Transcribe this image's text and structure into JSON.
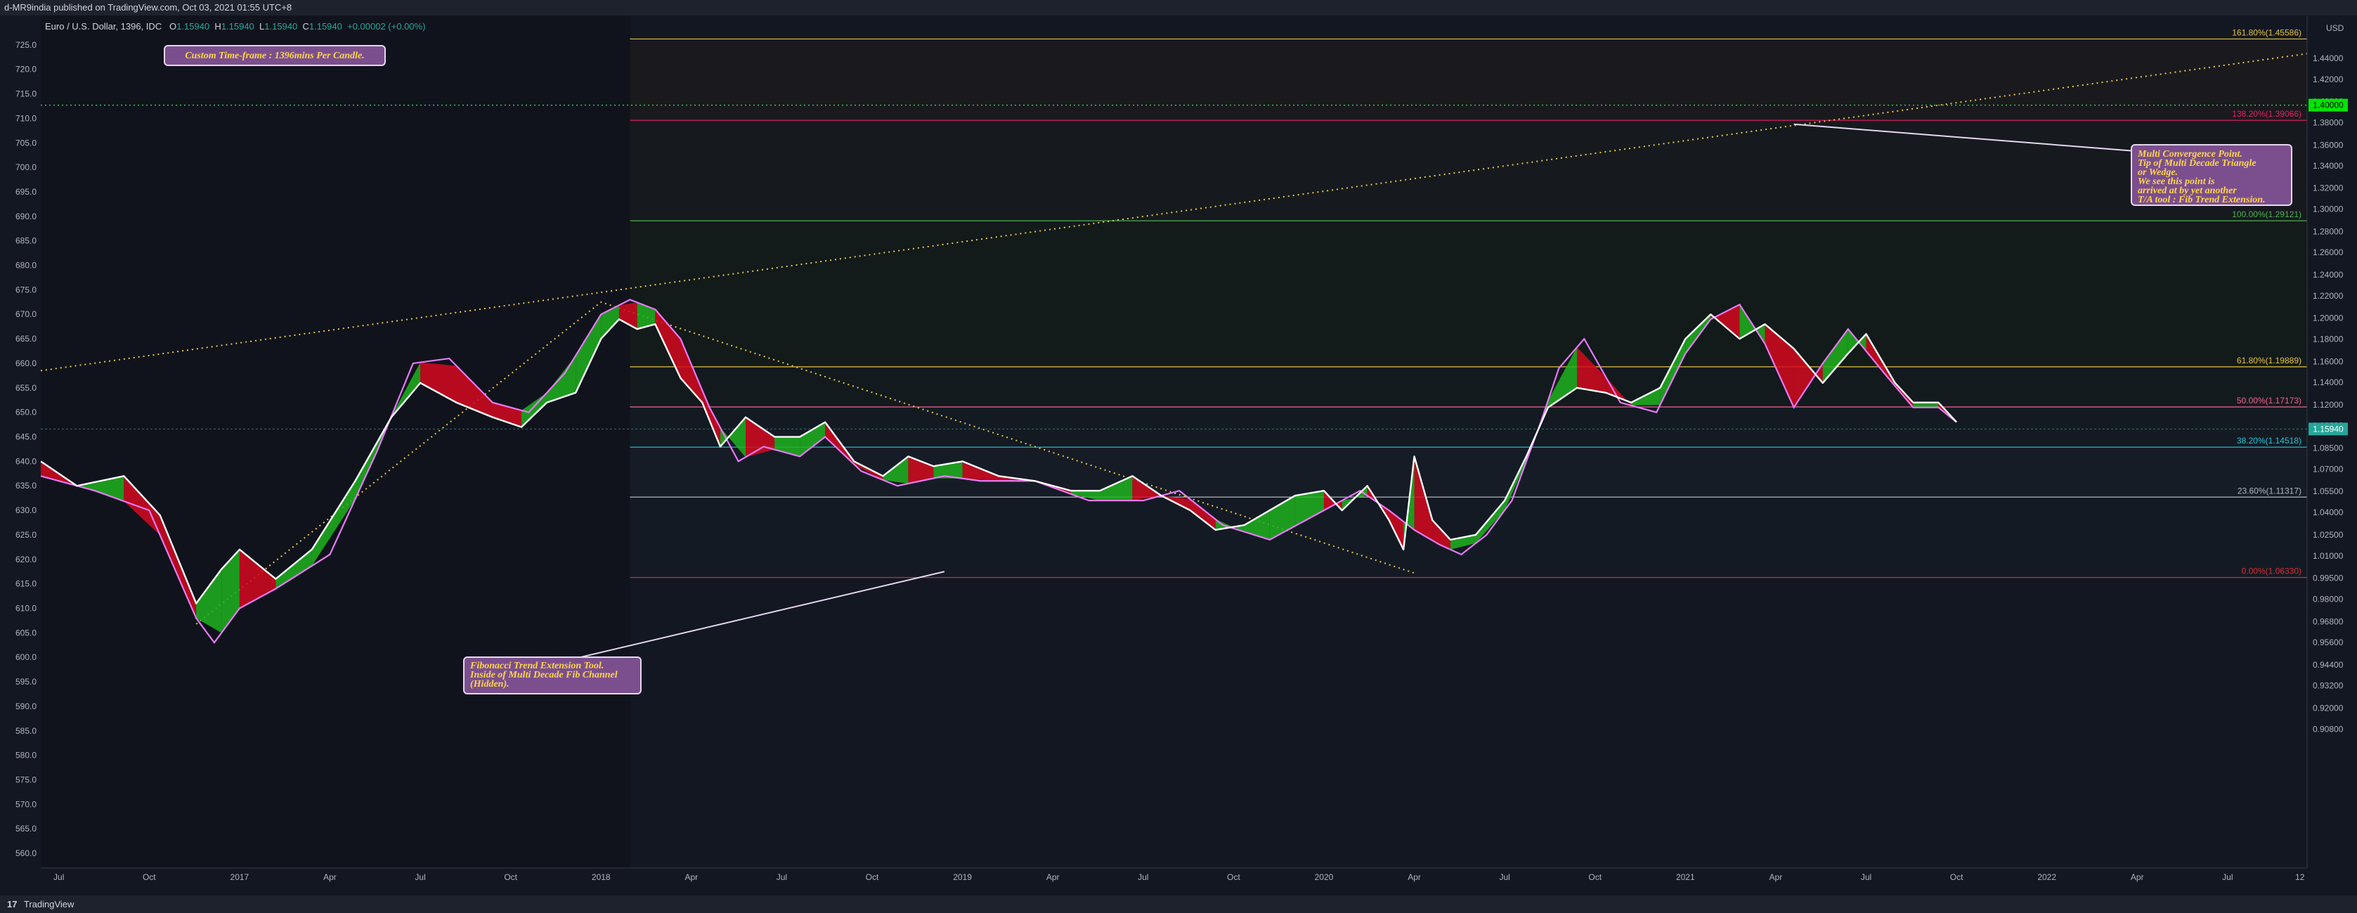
{
  "header": {
    "publisher": "d-MR9india published on TradingView.com, Oct 03, 2021 01:55 UTC+8",
    "symbol": "Euro / U.S. Dollar, 1396, IDC",
    "ohlc": {
      "o_label": "O",
      "o": "1.15940",
      "h_label": "H",
      "h": "1.15940",
      "l_label": "L",
      "l": "1.15940",
      "c_label": "C",
      "c": "1.15940",
      "change": "+0.00002 (+0.00%)"
    }
  },
  "footer": {
    "logo": "17",
    "brand": "TradingView"
  },
  "annotations": {
    "timeframe": "Custom Time-frame : 1396mins Per Candle.",
    "fib_tool": [
      "Fibonacci Trend Extension Tool.",
      "Inside of Multi Decade Fib Channel",
      "(Hidden)."
    ],
    "convergence": [
      "Multi Convergence Point.",
      "Tip of Multi Decade Triangle",
      "or Wedge.",
      "We see this point is",
      "arrived at by yet another",
      "T/A tool : Fib Trend Extension."
    ]
  },
  "chart_data": {
    "type": "line",
    "title": "Euro / U.S. Dollar, 1396, IDC",
    "right_axis_unit": "USD",
    "colors": {
      "background": "#131722",
      "price": "#ffffff",
      "envelope": "#e879f9",
      "up_fill": "#1fb31f",
      "down_fill": "#d5091f",
      "trend": "#e8c546",
      "current_price": "#26a69a",
      "green_level": "#2ecc40"
    },
    "x_ticks": [
      "Jul",
      "Oct",
      "2017",
      "Apr",
      "Jul",
      "Oct",
      "2018",
      "Apr",
      "Jul",
      "Oct",
      "2019",
      "Apr",
      "Jul",
      "Oct",
      "2020",
      "Apr",
      "Jul",
      "Oct",
      "2021",
      "Apr",
      "Jul",
      "Oct",
      "2022",
      "Apr",
      "Jul",
      "12"
    ],
    "x_tick_t": [
      2016.5,
      2016.75,
      2017.0,
      2017.25,
      2017.5,
      2017.75,
      2018.0,
      2018.25,
      2018.5,
      2018.75,
      2019.0,
      2019.25,
      2019.5,
      2019.75,
      2020.0,
      2020.25,
      2020.5,
      2020.75,
      2021.0,
      2021.25,
      2021.5,
      2021.75,
      2022.0,
      2022.25,
      2022.5,
      2022.7
    ],
    "xlim": [
      2016.45,
      2022.72
    ],
    "left_axis": {
      "ylim": [
        557.0,
        731.0
      ],
      "ticks": [
        "725.0",
        "720.0",
        "715.0",
        "710.0",
        "705.0",
        "700.0",
        "695.0",
        "690.0",
        "685.0",
        "680.0",
        "675.0",
        "670.0",
        "665.0",
        "660.0",
        "655.0",
        "650.0",
        "645.0",
        "640.0",
        "635.0",
        "630.0",
        "625.0",
        "620.0",
        "615.0",
        "610.0",
        "605.0",
        "600.0",
        "595.0",
        "590.0",
        "585.0",
        "580.0",
        "575.0",
        "570.0",
        "565.0",
        "560.0"
      ]
    },
    "right_axis": {
      "ticks": [
        "1.44000",
        "1.42000",
        "1.40000",
        "1.38000",
        "1.36000",
        "1.34000",
        "1.32000",
        "1.30000",
        "1.28000",
        "1.26000",
        "1.24000",
        "1.22000",
        "1.20000",
        "1.18000",
        "1.16000",
        "1.14000",
        "1.12000",
        "1.10000",
        "1.08500",
        "1.07000",
        "1.05500",
        "1.04000",
        "1.02500",
        "1.01000",
        "0.99500",
        "0.98000",
        "0.96800",
        "0.95600",
        "0.94400",
        "0.93200",
        "0.92000",
        "0.90800"
      ],
      "tick_left_value": [
        722.25,
        717.94,
        713.4,
        709.11,
        704.55,
        700.3,
        695.75,
        691.5,
        686.91,
        682.65,
        678.07,
        673.79,
        669.24,
        664.96,
        660.38,
        656.1,
        651.55,
        647.27,
        642.69,
        638.41,
        633.86,
        629.58,
        625.0,
        620.72,
        616.17,
        611.89,
        607.31,
        603.03,
        598.48,
        594.2,
        589.62,
        585.34
      ]
    },
    "fib_levels": [
      {
        "label": "161.80%(1.45586)",
        "value": 726.2,
        "color": "#e3c341"
      },
      {
        "label": "138.20%(1.39066)",
        "value": 709.6,
        "color": "#e91e63"
      },
      {
        "label": "100.00%(1.29121)",
        "value": 689.1,
        "color": "#4caf50"
      },
      {
        "label": "61.80%(1.19889)",
        "value": 659.3,
        "color": "#e3c341"
      },
      {
        "label": "50.00%(1.17173)",
        "value": 651.1,
        "color": "#f06292"
      },
      {
        "label": "38.20%(1.14518)",
        "value": 642.9,
        "color": "#26c6da"
      },
      {
        "label": "23.60%(1.11317)",
        "value": 632.7,
        "color": "#b2b5be"
      },
      {
        "label": "0.00%(1.06330)",
        "value": 616.3,
        "color": "#d32f2f"
      }
    ],
    "fib_zone_start_t": 2018.08,
    "green_dotted_level": {
      "value": 712.7,
      "label": "1.40000"
    },
    "current_price": {
      "value": 646.6,
      "label": "1.15940"
    },
    "price": {
      "x": [
        2016.45,
        2016.55,
        2016.68,
        2016.78,
        2016.88,
        2016.95,
        2017.0,
        2017.1,
        2017.2,
        2017.32,
        2017.42,
        2017.5,
        2017.6,
        2017.7,
        2017.78,
        2017.85,
        2017.93,
        2018.0,
        2018.05,
        2018.1,
        2018.15,
        2018.22,
        2018.28,
        2018.33,
        2018.4,
        2018.48,
        2018.55,
        2018.62,
        2018.7,
        2018.78,
        2018.85,
        2018.92,
        2019.0,
        2019.1,
        2019.2,
        2019.3,
        2019.38,
        2019.47,
        2019.55,
        2019.63,
        2019.7,
        2019.78,
        2019.85,
        2019.92,
        2020.0,
        2020.05,
        2020.12,
        2020.18,
        2020.22,
        2020.25,
        2020.3,
        2020.35,
        2020.42,
        2020.5,
        2020.56,
        2020.62,
        2020.7,
        2020.78,
        2020.85,
        2020.93,
        2021.0,
        2021.07,
        2021.15,
        2021.22,
        2021.3,
        2021.38,
        2021.45,
        2021.5,
        2021.58,
        2021.63,
        2021.7,
        2021.75
      ],
      "y": [
        640,
        635,
        637,
        629,
        611,
        618,
        622,
        616,
        622,
        636,
        649,
        656,
        652,
        649,
        647,
        652,
        654,
        665,
        669,
        667,
        668,
        657,
        652,
        643,
        649,
        645,
        645,
        648,
        640,
        637,
        641,
        639,
        640,
        637,
        636,
        634,
        634,
        637,
        633,
        630,
        626,
        627,
        630,
        633,
        634,
        630,
        635,
        628,
        622,
        641,
        628,
        624,
        625,
        632,
        641,
        651,
        655,
        654,
        652,
        655,
        665,
        670,
        665,
        668,
        663,
        656,
        662,
        666,
        656,
        652,
        652,
        648
      ]
    },
    "envelope": {
      "x": [
        2016.45,
        2016.6,
        2016.75,
        2016.88,
        2016.93,
        2017.0,
        2017.1,
        2017.25,
        2017.38,
        2017.48,
        2017.58,
        2017.7,
        2017.8,
        2017.9,
        2018.0,
        2018.08,
        2018.15,
        2018.22,
        2018.3,
        2018.38,
        2018.45,
        2018.55,
        2018.62,
        2018.72,
        2018.82,
        2018.95,
        2019.05,
        2019.2,
        2019.35,
        2019.5,
        2019.6,
        2019.72,
        2019.85,
        2020.0,
        2020.1,
        2020.18,
        2020.25,
        2020.32,
        2020.38,
        2020.45,
        2020.52,
        2020.6,
        2020.65,
        2020.72,
        2020.82,
        2020.92,
        2021.0,
        2021.07,
        2021.15,
        2021.22,
        2021.3,
        2021.38,
        2021.45,
        2021.55,
        2021.63,
        2021.7,
        2021.75
      ],
      "y": [
        637,
        634,
        630,
        608,
        603,
        610,
        614,
        621,
        642,
        660,
        661,
        652,
        650,
        658,
        670,
        673,
        671,
        665,
        651,
        640,
        643,
        641,
        645,
        638,
        635,
        637,
        636,
        636,
        632,
        632,
        634,
        627,
        624,
        630,
        634,
        630,
        626,
        623,
        621,
        625,
        632,
        648,
        659,
        665,
        652,
        650,
        662,
        669,
        672,
        664,
        651,
        660,
        667,
        658,
        651,
        651,
        648
      ]
    },
    "trend_lines": [
      {
        "style": "dotted",
        "points": [
          [
            2016.45,
            658.5
          ],
          [
            2022.72,
            723.2
          ]
        ]
      },
      {
        "style": "dotted",
        "points": [
          [
            2016.88,
            606.8
          ],
          [
            2018.0,
            672.5
          ],
          [
            2020.25,
            617.2
          ]
        ]
      }
    ],
    "annotation_pointers": [
      {
        "from": [
          2017.7,
          595.8
        ],
        "to": [
          2018.95,
          617.5
        ]
      },
      {
        "from": [
          2022.3,
          703.0
        ],
        "to": [
          2021.3,
          708.8
        ]
      }
    ]
  }
}
